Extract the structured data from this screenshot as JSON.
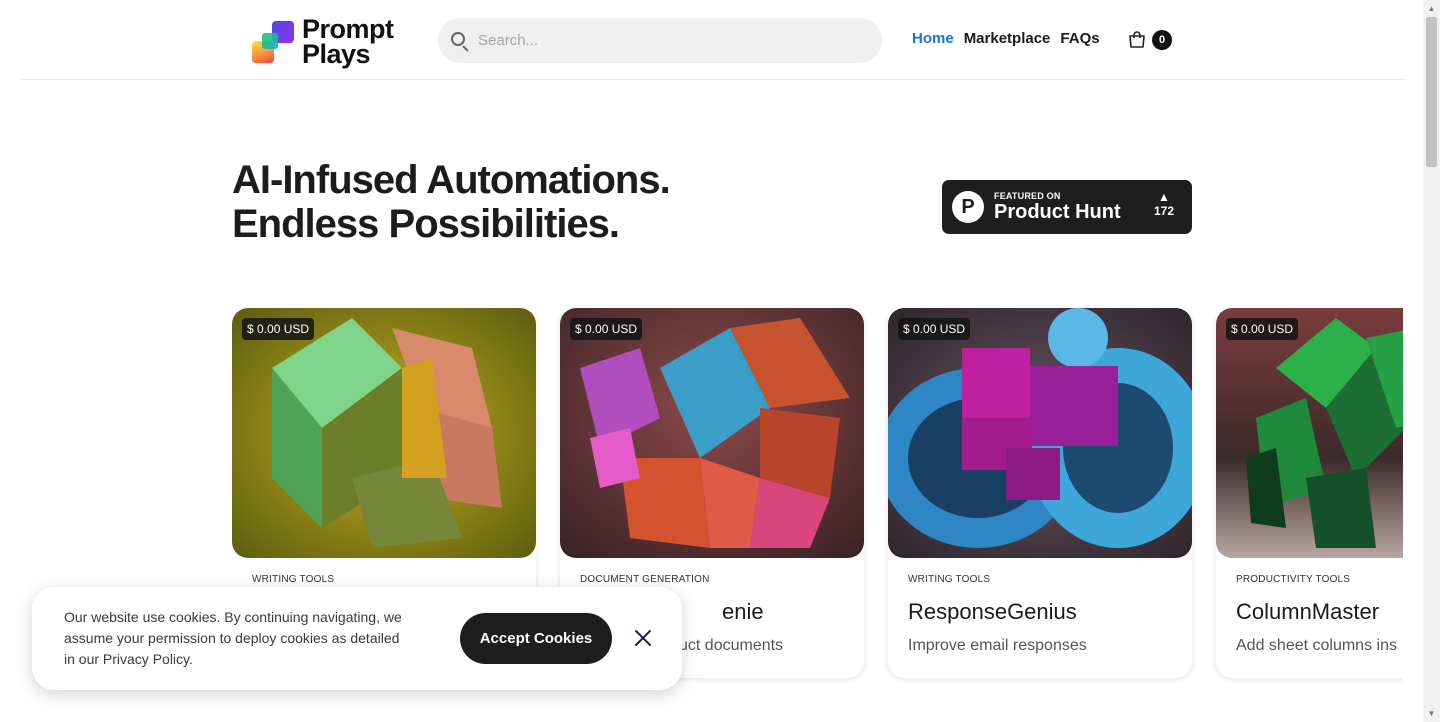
{
  "brand": {
    "name_line1": "Prompt",
    "name_line2": "Plays"
  },
  "search": {
    "placeholder": "Search..."
  },
  "nav": {
    "home": "Home",
    "marketplace": "Marketplace",
    "faqs": "FAQs"
  },
  "cart": {
    "count": "0"
  },
  "hero": {
    "line1": "AI-Infused Automations.",
    "line2": "Endless Possibilities."
  },
  "product_hunt": {
    "featured": "FEATURED ON",
    "name": "Product Hunt",
    "votes": "172",
    "logo_letter": "P",
    "arrow": "▲"
  },
  "cards": [
    {
      "price": "$ 0.00 USD",
      "category": "WRITING TOOLS",
      "title": "",
      "description": ""
    },
    {
      "price": "$ 0.00 USD",
      "category": "DOCUMENT GENERATION",
      "title": "enie",
      "description": "uct documents"
    },
    {
      "price": "$ 0.00 USD",
      "category": "WRITING TOOLS",
      "title": "ResponseGenius",
      "description": "Improve email responses"
    },
    {
      "price": "$ 0.00 USD",
      "category": "PRODUCTIVITY TOOLS",
      "title": "ColumnMaster",
      "description": "Add sheet columns ins"
    }
  ],
  "cookie": {
    "text": "Our website use cookies. By continuing navigating, we assume your permission to deploy cookies as detailed in our Privacy Policy.",
    "accept": "Accept Cookies"
  },
  "colors": {
    "accent": "#1d74d8",
    "dark": "#1e1e1e"
  }
}
